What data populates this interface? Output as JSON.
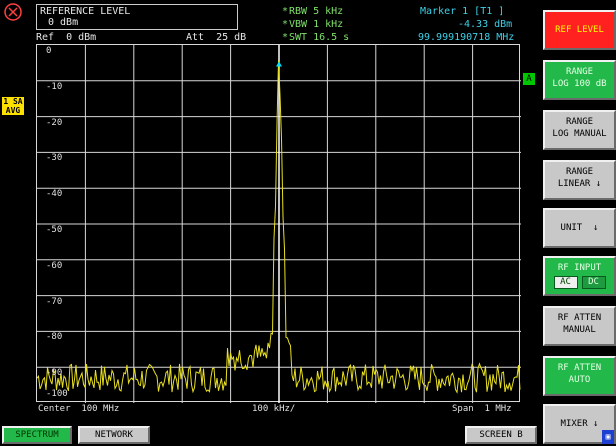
{
  "header": {
    "ref_title": "REFERENCE LEVEL",
    "ref_value": "0 dBm",
    "ref_label": "Ref  0 dBm",
    "att_label": "Att  25 dB",
    "rbw": "RBW 5 kHz",
    "vbw": "VBW 1 kHz",
    "swt": "SWT 16.5 s",
    "marker_title": "Marker 1 [T1 ]",
    "marker_level": "-4.33 dBm",
    "marker_freq": "99.999190718 MHz",
    "bullet": "*"
  },
  "trace_badge": {
    "line1": "1 SA",
    "line2": "AVG"
  },
  "a_marker": "A",
  "plot": {
    "y_labels": [
      "0",
      "-10",
      "-20",
      "-30",
      "-40",
      "-50",
      "-60",
      "-70",
      "-80",
      "-90",
      "-100"
    ],
    "x_left": "Center  100 MHz",
    "x_center": "100 kHz/",
    "x_right": "Span  1 MHz",
    "colors": {
      "grid": "#d8d8d8",
      "trace": "#e8e020",
      "marker": "#00e0ff",
      "center_line": "#ffffff"
    }
  },
  "chart_data": {
    "type": "line",
    "ylim": [
      -100,
      0
    ],
    "xlim_mhz": [
      99.5,
      100.5
    ],
    "noise_floor_dbm": -93,
    "peak": {
      "x_mhz": 100.0,
      "y_dbm": -4.33
    },
    "grid": true
  },
  "softkeys": [
    {
      "line1": "REF LEVEL",
      "line2": "",
      "style": "red"
    },
    {
      "line1": "RANGE",
      "line2": "LOG 100 dB",
      "style": "green"
    },
    {
      "line1": "RANGE",
      "line2": "LOG MANUAL",
      "style": "gray"
    },
    {
      "line1": "RANGE",
      "line2": "LINEAR ↓",
      "style": "gray"
    },
    {
      "line1": "UNIT  ↓",
      "line2": "",
      "style": "gray"
    },
    {
      "line1": "RF INPUT",
      "line2": "",
      "style": "green",
      "options": [
        "AC",
        "DC"
      ],
      "selected": "AC"
    },
    {
      "line1": "RF ATTEN",
      "line2": "MANUAL",
      "style": "gray"
    },
    {
      "line1": "RF ATTEN",
      "line2": "AUTO",
      "style": "green"
    },
    {
      "line1": "MIXER ↓",
      "line2": "",
      "style": "gray"
    }
  ],
  "bottom": {
    "spectrum": "SPECTRUM",
    "network": "NETWORK",
    "screen_b": "SCREEN B",
    "corner_icon": "▣"
  }
}
